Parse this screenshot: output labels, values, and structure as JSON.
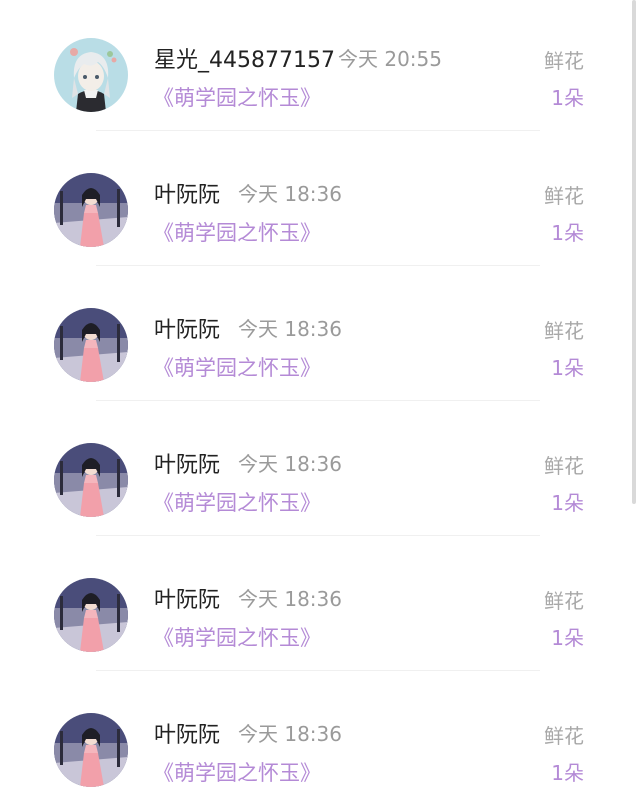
{
  "records": [
    {
      "username": "星光_445877157",
      "time": "今天 20:55",
      "book": "《萌学园之怀玉》",
      "gift_label": "鲜花",
      "gift_count": "1朵",
      "avatar": "white-hair-girl-avatar"
    },
    {
      "username": "叶阮阮",
      "time": "今天 18:36",
      "book": "《萌学园之怀玉》",
      "gift_label": "鲜花",
      "gift_count": "1朵",
      "avatar": "pink-dress-girl-avatar"
    },
    {
      "username": "叶阮阮",
      "time": "今天 18:36",
      "book": "《萌学园之怀玉》",
      "gift_label": "鲜花",
      "gift_count": "1朵",
      "avatar": "pink-dress-girl-avatar"
    },
    {
      "username": "叶阮阮",
      "time": "今天 18:36",
      "book": "《萌学园之怀玉》",
      "gift_label": "鲜花",
      "gift_count": "1朵",
      "avatar": "pink-dress-girl-avatar"
    },
    {
      "username": "叶阮阮",
      "time": "今天 18:36",
      "book": "《萌学园之怀玉》",
      "gift_label": "鲜花",
      "gift_count": "1朵",
      "avatar": "pink-dress-girl-avatar"
    },
    {
      "username": "叶阮阮",
      "time": "今天 18:36",
      "book": "《萌学园之怀玉》",
      "gift_label": "鲜花",
      "gift_count": "1朵",
      "avatar": "pink-dress-girl-avatar"
    }
  ],
  "colors": {
    "accent": "#b48ad6",
    "username": "#222222",
    "muted": "#9a9a9a"
  }
}
